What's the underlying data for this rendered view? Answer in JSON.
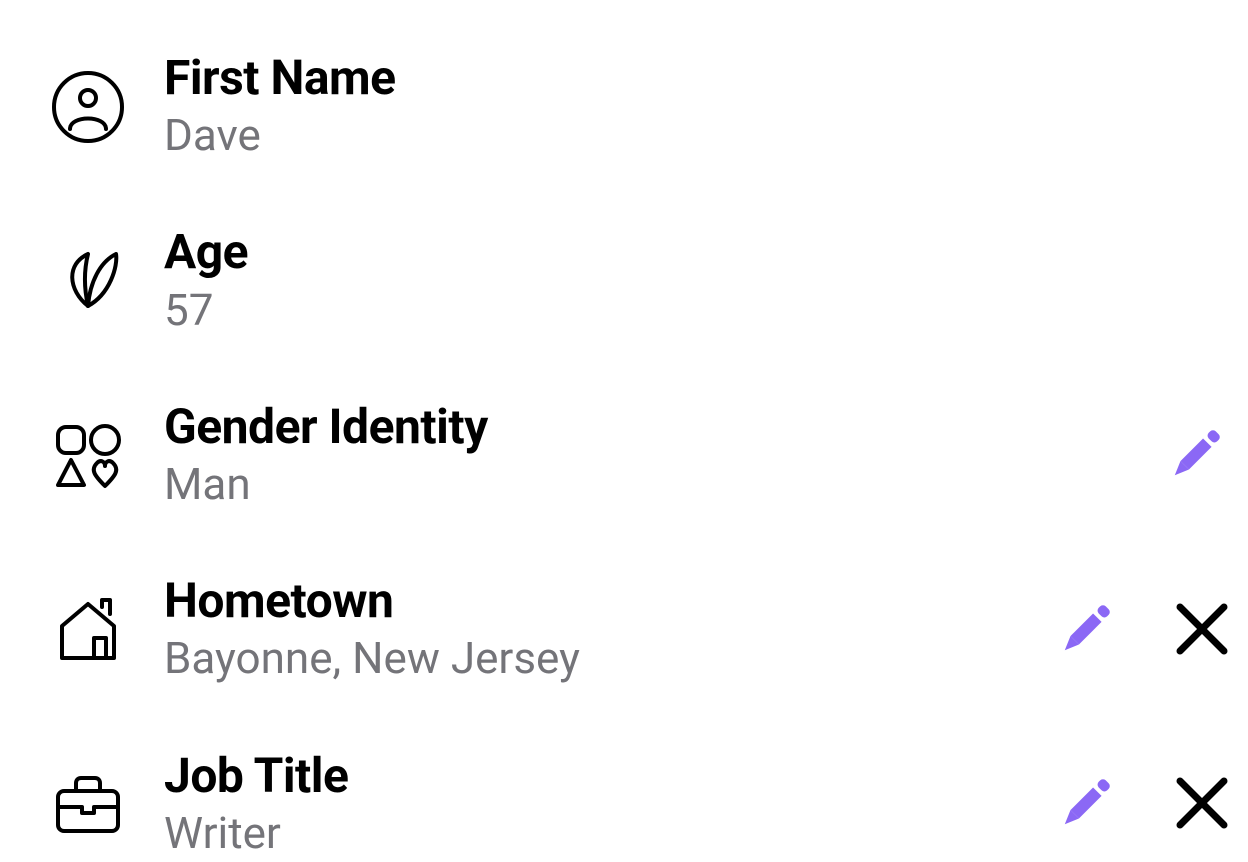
{
  "colors": {
    "accent": "#8B68F5",
    "label": "#000000",
    "value": "#747479"
  },
  "profile": {
    "items": [
      {
        "icon": "person-icon",
        "label": "First Name",
        "value": "Dave",
        "editable": false,
        "removable": false
      },
      {
        "icon": "leaf-icon",
        "label": "Age",
        "value": "57",
        "editable": false,
        "removable": false
      },
      {
        "icon": "shapes-icon",
        "label": "Gender Identity",
        "value": "Man",
        "editable": true,
        "removable": false
      },
      {
        "icon": "house-icon",
        "label": "Hometown",
        "value": "Bayonne, New Jersey",
        "editable": true,
        "removable": true
      },
      {
        "icon": "briefcase-icon",
        "label": "Job Title",
        "value": "Writer",
        "editable": true,
        "removable": true
      }
    ]
  }
}
